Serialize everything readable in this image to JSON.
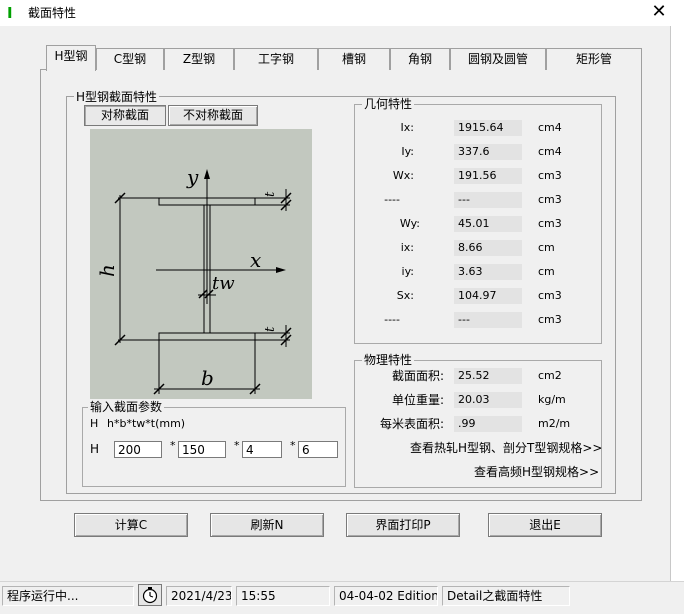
{
  "window": {
    "title": "截面特性",
    "app_icon_glyph": "I",
    "close_glyph": "✕"
  },
  "tabs": [
    {
      "label": "H型钢",
      "active": true
    },
    {
      "label": "C型钢",
      "active": false
    },
    {
      "label": "Z型钢",
      "active": false
    },
    {
      "label": "工字钢",
      "active": false
    },
    {
      "label": "槽钢",
      "active": false
    },
    {
      "label": "角钢",
      "active": false
    },
    {
      "label": "圆钢及圆管",
      "active": false
    },
    {
      "label": "矩形管",
      "active": false
    }
  ],
  "section": {
    "group_label": "H型钢截面特性",
    "symmetric_label": "对称截面",
    "asymmetric_label": "不对称截面"
  },
  "diagram": {
    "y_label": "y",
    "x_label": "x",
    "h_label": "h",
    "b_label": "b",
    "tw_label": "tw",
    "t_top_label": "t",
    "t_bottom_label": "t"
  },
  "inputs": {
    "group_label": "输入截面参数",
    "prefix": "H",
    "formula": "h*b*tw*t(mm)",
    "row_label": "H",
    "separator": "*",
    "h_value": "200",
    "b_value": "150",
    "tw_value": "4",
    "t_value": "6"
  },
  "geometry": {
    "group_label": "几何特性",
    "rows": [
      {
        "label": "Ix:",
        "value": "1915.64",
        "unit": "cm4"
      },
      {
        "label": "Iy:",
        "value": "337.6",
        "unit": "cm4"
      },
      {
        "label": "Wx:",
        "value": "191.56",
        "unit": "cm3"
      },
      {
        "label": "----",
        "value": "---",
        "unit": "cm3"
      },
      {
        "label": "Wy:",
        "value": "45.01",
        "unit": "cm3"
      },
      {
        "label": "ix:",
        "value": "8.66",
        "unit": "cm"
      },
      {
        "label": "iy:",
        "value": "3.63",
        "unit": "cm"
      },
      {
        "label": "Sx:",
        "value": "104.97",
        "unit": "cm3"
      },
      {
        "label": "----",
        "value": "---",
        "unit": "cm3"
      }
    ]
  },
  "physical": {
    "group_label": "物理特性",
    "rows": [
      {
        "label": "截面面积:",
        "value": "25.52",
        "unit": "cm2"
      },
      {
        "label": "单位重量:",
        "value": "20.03",
        "unit": "kg/m"
      },
      {
        "label": "每米表面积:",
        "value": ".99",
        "unit": "m2/m"
      }
    ],
    "link_hot_rolled": "查看热轧H型钢、剖分T型钢规格>>",
    "link_high_freq": "查看高频H型钢规格>>"
  },
  "buttons": {
    "calc": "计算C",
    "refresh": "刷新N",
    "print": "界面打印P",
    "exit": "退出E"
  },
  "status": {
    "running": "程序运行中...",
    "date": "2021/4/23",
    "time": "15:55",
    "edition": "04-04-02 Edition",
    "module": "Detail之截面特性"
  },
  "colors": {
    "diagram_bg": "#c2c8bf",
    "app_icon": "#00a000"
  }
}
